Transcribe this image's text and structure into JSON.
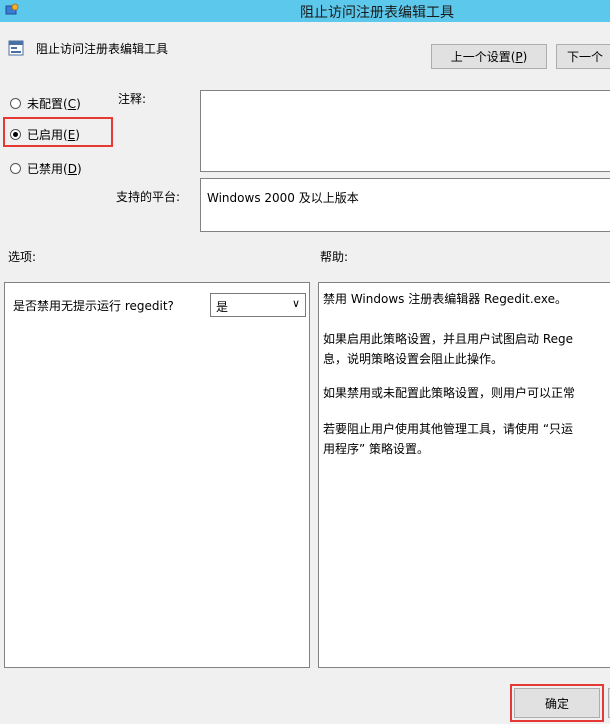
{
  "window": {
    "title": "阻止访问注册表编辑工具",
    "icon": "registry-tool-icon"
  },
  "policy": {
    "name": "阻止访问注册表编辑工具",
    "icon": "policy-setting-icon"
  },
  "nav": {
    "prev_label": "上一个设置(",
    "prev_key": "P",
    "prev_suffix": ")",
    "next_label": "下一个"
  },
  "state": {
    "not_configured": {
      "label": "未配置(",
      "key": "C",
      "suffix": ")",
      "checked": false
    },
    "enabled": {
      "label": "已启用(",
      "key": "E",
      "suffix": ")",
      "checked": true
    },
    "disabled": {
      "label": "已禁用(",
      "key": "D",
      "suffix": ")",
      "checked": false
    }
  },
  "comment": {
    "label": "注释:",
    "value": ""
  },
  "platform": {
    "label": "支持的平台:",
    "value": "Windows 2000 及以上版本"
  },
  "options": {
    "label": "选项:",
    "regedit_question": "是否禁用无提示运行 regedit?",
    "regedit_value": "是"
  },
  "help": {
    "label": "帮助:",
    "lines": [
      "禁用 Windows 注册表编辑器 Regedit.exe。",
      "如果启用此策略设置，并且用户试图启动 Rege",
      "息，说明策略设置会阻止此操作。",
      "如果禁用或未配置此策略设置，则用户可以正常",
      "若要阻止用户使用其他管理工具，请使用 “只运",
      "用程序” 策略设置。"
    ]
  },
  "footer": {
    "ok_label": "确定"
  },
  "colors": {
    "titlebar": "#5cc8ec",
    "highlight": "#e53935",
    "window_bg": "#f0f0f0"
  }
}
